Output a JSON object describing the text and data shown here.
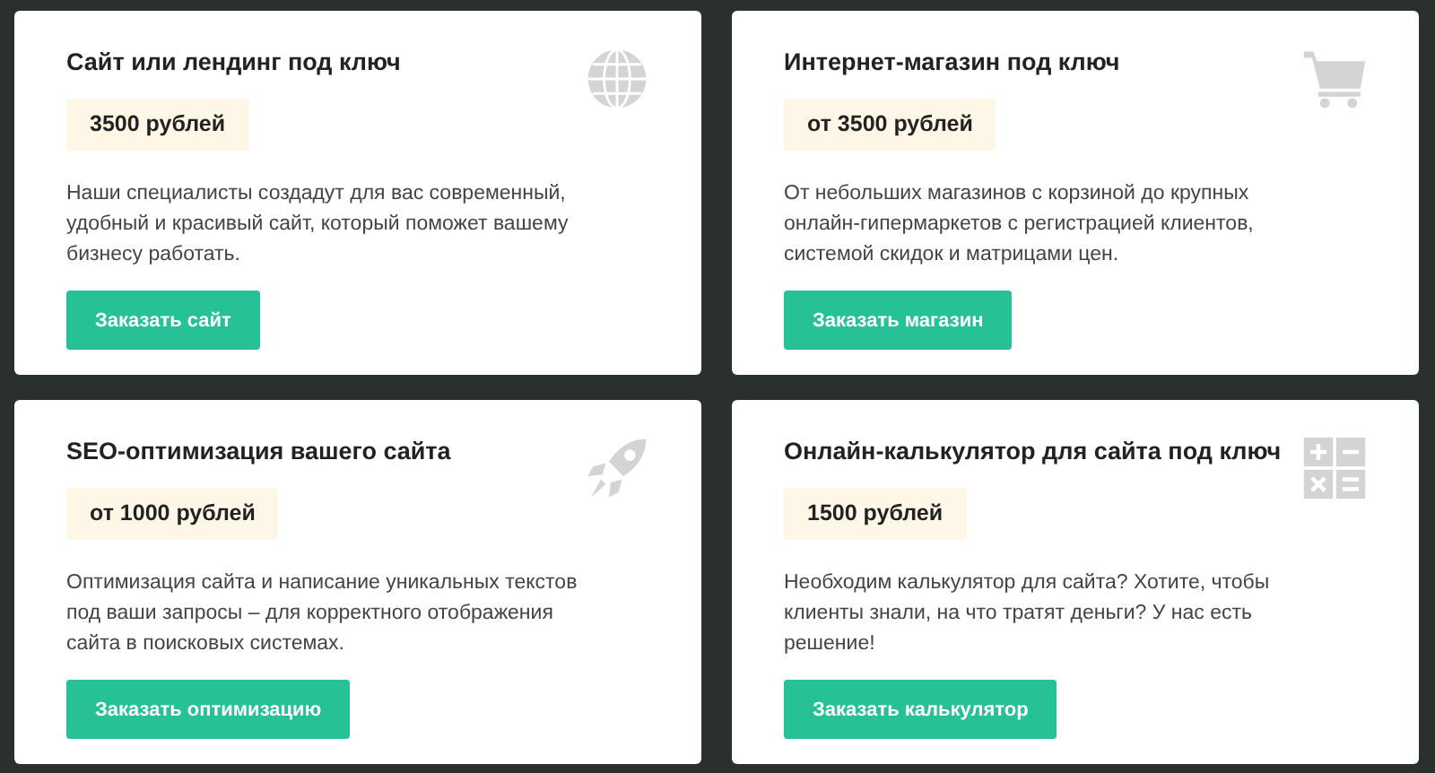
{
  "cards": [
    {
      "kind": "globe",
      "title": "Сайт или лендинг под ключ",
      "price": "3500 рублей",
      "description": "Наши специалисты создадут для вас современный, удобный и красивый сайт, который поможет вашему бизнесу работать.",
      "button": "Заказать сайт"
    },
    {
      "kind": "cart",
      "title": "Интернет-магазин под ключ",
      "price": "от 3500 рублей",
      "description": "От небольших магазинов с корзиной до крупных онлайн-гипермаркетов с регистрацией клиентов, системой скидок и матрицами цен.",
      "button": "Заказать магазин"
    },
    {
      "kind": "rocket",
      "title": "SEO-оптимизация вашего сайта",
      "price": "от 1000 рублей",
      "description": "Оптимизация сайта и написание уникальных текстов под ваши запросы – для корректного отображения сайта в поисковых системах.",
      "button": "Заказать оптимизацию"
    },
    {
      "kind": "calculator",
      "title": "Онлайн-калькулятор для сайта под ключ",
      "price": "1500 рублей",
      "description": "Необходим калькулятор для сайта? Хотите, чтобы клиенты знали, на что тратят деньги? У нас есть решение!",
      "button": "Заказать калькулятор"
    }
  ]
}
